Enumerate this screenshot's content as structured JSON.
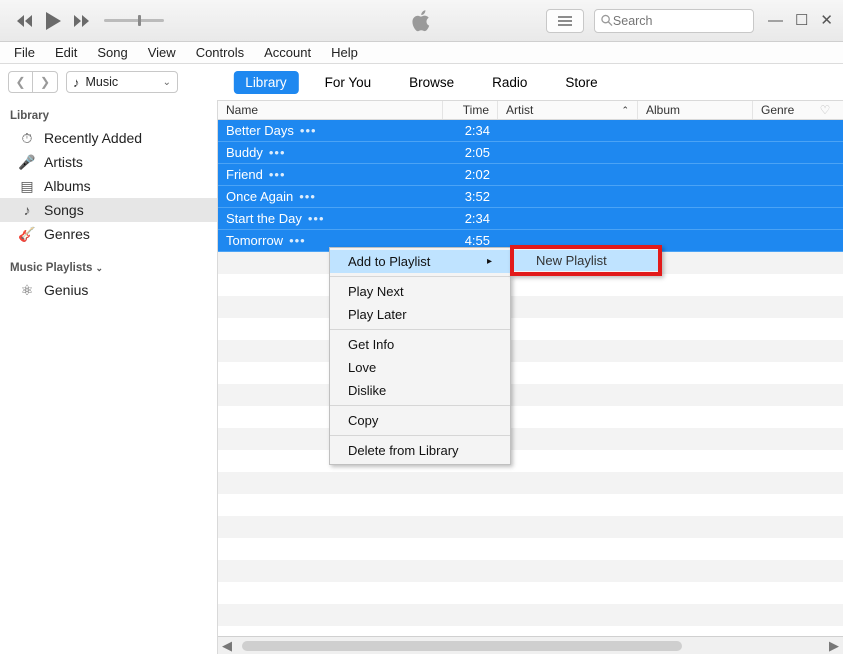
{
  "titlebar": {
    "search_placeholder": "Search"
  },
  "menubar": [
    "File",
    "Edit",
    "Song",
    "View",
    "Controls",
    "Account",
    "Help"
  ],
  "media_selector": {
    "label": "Music"
  },
  "tabs": [
    {
      "label": "Library",
      "active": true
    },
    {
      "label": "For You",
      "active": false
    },
    {
      "label": "Browse",
      "active": false
    },
    {
      "label": "Radio",
      "active": false
    },
    {
      "label": "Store",
      "active": false
    }
  ],
  "sidebar": {
    "library_label": "Library",
    "library_items": [
      {
        "label": "Recently Added",
        "icon": "clock-add-icon"
      },
      {
        "label": "Artists",
        "icon": "mic-icon"
      },
      {
        "label": "Albums",
        "icon": "album-icon"
      },
      {
        "label": "Songs",
        "icon": "note-icon",
        "selected": true
      },
      {
        "label": "Genres",
        "icon": "guitar-icon"
      }
    ],
    "playlists_label": "Music Playlists",
    "playlists": [
      {
        "label": "Genius",
        "icon": "genius-icon"
      }
    ]
  },
  "columns": {
    "name": "Name",
    "time": "Time",
    "artist": "Artist",
    "album": "Album",
    "genre": "Genre"
  },
  "songs": [
    {
      "name": "Better Days",
      "time": "2:34",
      "selected": true
    },
    {
      "name": "Buddy",
      "time": "2:05",
      "selected": true
    },
    {
      "name": "Friend",
      "time": "2:02",
      "selected": true
    },
    {
      "name": "Once Again",
      "time": "3:52",
      "selected": true
    },
    {
      "name": "Start the Day",
      "time": "2:34",
      "selected": true
    },
    {
      "name": "Tomorrow",
      "time": "4:55",
      "selected": true
    }
  ],
  "context_menu": {
    "items": [
      {
        "label": "Add to Playlist",
        "submenu": true,
        "highlight": true
      },
      {
        "sep": true
      },
      {
        "label": "Play Next"
      },
      {
        "label": "Play Later"
      },
      {
        "sep": true
      },
      {
        "label": "Get Info"
      },
      {
        "label": "Love"
      },
      {
        "label": "Dislike"
      },
      {
        "sep": true
      },
      {
        "label": "Copy"
      },
      {
        "sep": true
      },
      {
        "label": "Delete from Library"
      }
    ],
    "submenu_item": "New Playlist"
  }
}
